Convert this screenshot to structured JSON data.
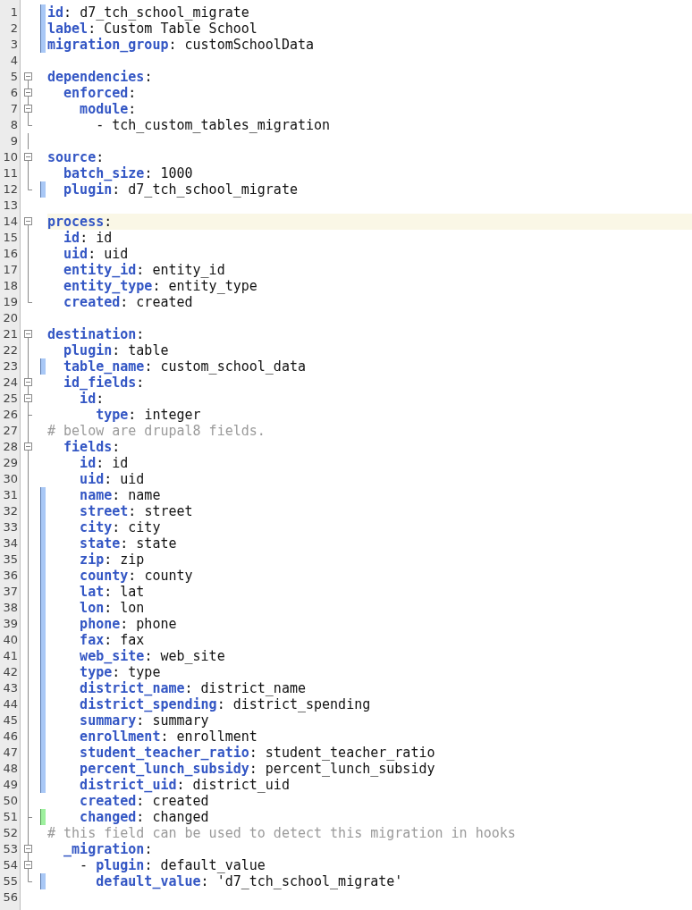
{
  "editor": {
    "lines": [
      {
        "number": "1",
        "kind": "plain",
        "modified": true,
        "added": false,
        "current": false,
        "segments": [
          {
            "kind": "key",
            "text": "id"
          },
          {
            "kind": "punct",
            "text": ": "
          },
          {
            "kind": "value",
            "text": "d7_tch_school_migrate"
          }
        ]
      },
      {
        "number": "2",
        "kind": "plain",
        "modified": true,
        "added": false,
        "current": false,
        "segments": [
          {
            "kind": "key",
            "text": "label"
          },
          {
            "kind": "punct",
            "text": ": "
          },
          {
            "kind": "value",
            "text": "Custom Table School"
          }
        ]
      },
      {
        "number": "3",
        "kind": "plain",
        "modified": true,
        "added": false,
        "current": false,
        "segments": [
          {
            "kind": "key",
            "text": "migration_group"
          },
          {
            "kind": "punct",
            "text": ": "
          },
          {
            "kind": "value",
            "text": "customSchoolData"
          }
        ]
      },
      {
        "number": "4",
        "kind": "plain",
        "modified": false,
        "added": false,
        "current": false
      },
      {
        "number": "5",
        "kind": "start",
        "modified": false,
        "added": false,
        "current": false,
        "segments": [
          {
            "kind": "key",
            "text": "dependencies"
          },
          {
            "kind": "punct",
            "text": ":"
          }
        ]
      },
      {
        "number": "6",
        "kind": "nested",
        "modified": false,
        "added": false,
        "current": false,
        "segments": [
          {
            "kind": "key",
            "text": "  enforced"
          },
          {
            "kind": "punct",
            "text": ":"
          }
        ]
      },
      {
        "number": "7",
        "kind": "nested",
        "modified": false,
        "added": false,
        "current": false,
        "segments": [
          {
            "kind": "key",
            "text": "    module"
          },
          {
            "kind": "punct",
            "text": ":"
          }
        ]
      },
      {
        "number": "8",
        "kind": "end",
        "modified": false,
        "added": false,
        "current": false,
        "segments": [
          {
            "kind": "value",
            "text": "      - tch_custom_tables_migration"
          }
        ]
      },
      {
        "number": "9",
        "kind": "line",
        "modified": false,
        "added": false,
        "current": false
      },
      {
        "number": "10",
        "kind": "start",
        "modified": false,
        "added": false,
        "current": false,
        "segments": [
          {
            "kind": "key",
            "text": "source"
          },
          {
            "kind": "punct",
            "text": ":"
          }
        ]
      },
      {
        "number": "11",
        "kind": "line",
        "modified": false,
        "added": false,
        "current": false,
        "segments": [
          {
            "kind": "key",
            "text": "  batch_size"
          },
          {
            "kind": "punct",
            "text": ": "
          },
          {
            "kind": "value",
            "text": "1000"
          }
        ]
      },
      {
        "number": "12",
        "kind": "end",
        "modified": true,
        "added": false,
        "current": false,
        "segments": [
          {
            "kind": "key",
            "text": "  plugin"
          },
          {
            "kind": "punct",
            "text": ": "
          },
          {
            "kind": "value",
            "text": "d7_tch_school_migrate"
          }
        ]
      },
      {
        "number": "13",
        "kind": "plain",
        "modified": false,
        "added": false,
        "current": false
      },
      {
        "number": "14",
        "kind": "start",
        "modified": false,
        "added": false,
        "current": true,
        "segments": [
          {
            "kind": "key",
            "text": "process"
          },
          {
            "kind": "punct",
            "text": ":"
          }
        ]
      },
      {
        "number": "15",
        "kind": "line",
        "modified": false,
        "added": false,
        "current": false,
        "segments": [
          {
            "kind": "key",
            "text": "  id"
          },
          {
            "kind": "punct",
            "text": ": "
          },
          {
            "kind": "value",
            "text": "id"
          }
        ]
      },
      {
        "number": "16",
        "kind": "line",
        "modified": false,
        "added": false,
        "current": false,
        "segments": [
          {
            "kind": "key",
            "text": "  uid"
          },
          {
            "kind": "punct",
            "text": ": "
          },
          {
            "kind": "value",
            "text": "uid"
          }
        ]
      },
      {
        "number": "17",
        "kind": "line",
        "modified": false,
        "added": false,
        "current": false,
        "segments": [
          {
            "kind": "key",
            "text": "  entity_id"
          },
          {
            "kind": "punct",
            "text": ": "
          },
          {
            "kind": "value",
            "text": "entity_id"
          }
        ]
      },
      {
        "number": "18",
        "kind": "line",
        "modified": false,
        "added": false,
        "current": false,
        "segments": [
          {
            "kind": "key",
            "text": "  entity_type"
          },
          {
            "kind": "punct",
            "text": ": "
          },
          {
            "kind": "value",
            "text": "entity_type"
          }
        ]
      },
      {
        "number": "19",
        "kind": "end",
        "modified": false,
        "added": false,
        "current": false,
        "segments": [
          {
            "kind": "key",
            "text": "  created"
          },
          {
            "kind": "punct",
            "text": ": "
          },
          {
            "kind": "value",
            "text": "created"
          }
        ]
      },
      {
        "number": "20",
        "kind": "plain",
        "modified": false,
        "added": false,
        "current": false
      },
      {
        "number": "21",
        "kind": "start",
        "modified": false,
        "added": false,
        "current": false,
        "segments": [
          {
            "kind": "key",
            "text": "destination"
          },
          {
            "kind": "punct",
            "text": ":"
          }
        ]
      },
      {
        "number": "22",
        "kind": "line",
        "modified": false,
        "added": false,
        "current": false,
        "segments": [
          {
            "kind": "key",
            "text": "  plugin"
          },
          {
            "kind": "punct",
            "text": ": "
          },
          {
            "kind": "value",
            "text": "table"
          }
        ]
      },
      {
        "number": "23",
        "kind": "line",
        "modified": true,
        "added": false,
        "current": false,
        "segments": [
          {
            "kind": "key",
            "text": "  table_name"
          },
          {
            "kind": "punct",
            "text": ": "
          },
          {
            "kind": "value",
            "text": "custom_school_data"
          }
        ]
      },
      {
        "number": "24",
        "kind": "nested",
        "modified": false,
        "added": false,
        "current": false,
        "segments": [
          {
            "kind": "key",
            "text": "  id_fields"
          },
          {
            "kind": "punct",
            "text": ":"
          }
        ]
      },
      {
        "number": "25",
        "kind": "nested",
        "modified": false,
        "added": false,
        "current": false,
        "segments": [
          {
            "kind": "key",
            "text": "    id"
          },
          {
            "kind": "punct",
            "text": ":"
          }
        ]
      },
      {
        "number": "26",
        "kind": "tee",
        "modified": false,
        "added": false,
        "current": false,
        "segments": [
          {
            "kind": "key",
            "text": "      type"
          },
          {
            "kind": "punct",
            "text": ": "
          },
          {
            "kind": "value",
            "text": "integer"
          }
        ]
      },
      {
        "number": "27",
        "kind": "line",
        "modified": false,
        "added": false,
        "current": false,
        "segments": [
          {
            "kind": "comment",
            "text": "# below are drupal8 fields."
          }
        ]
      },
      {
        "number": "28",
        "kind": "nested",
        "modified": false,
        "added": false,
        "current": false,
        "segments": [
          {
            "kind": "key",
            "text": "  fields"
          },
          {
            "kind": "punct",
            "text": ":"
          }
        ]
      },
      {
        "number": "29",
        "kind": "line",
        "modified": false,
        "added": false,
        "current": false,
        "segments": [
          {
            "kind": "key",
            "text": "    id"
          },
          {
            "kind": "punct",
            "text": ": "
          },
          {
            "kind": "value",
            "text": "id"
          }
        ]
      },
      {
        "number": "30",
        "kind": "line",
        "modified": false,
        "added": false,
        "current": false,
        "segments": [
          {
            "kind": "key",
            "text": "    uid"
          },
          {
            "kind": "punct",
            "text": ": "
          },
          {
            "kind": "value",
            "text": "uid"
          }
        ]
      },
      {
        "number": "31",
        "kind": "line",
        "modified": true,
        "added": false,
        "current": false,
        "segments": [
          {
            "kind": "key",
            "text": "    name"
          },
          {
            "kind": "punct",
            "text": ": "
          },
          {
            "kind": "value",
            "text": "name"
          }
        ]
      },
      {
        "number": "32",
        "kind": "line",
        "modified": true,
        "added": false,
        "current": false,
        "segments": [
          {
            "kind": "key",
            "text": "    street"
          },
          {
            "kind": "punct",
            "text": ": "
          },
          {
            "kind": "value",
            "text": "street"
          }
        ]
      },
      {
        "number": "33",
        "kind": "line",
        "modified": true,
        "added": false,
        "current": false,
        "segments": [
          {
            "kind": "key",
            "text": "    city"
          },
          {
            "kind": "punct",
            "text": ": "
          },
          {
            "kind": "value",
            "text": "city"
          }
        ]
      },
      {
        "number": "34",
        "kind": "line",
        "modified": true,
        "added": false,
        "current": false,
        "segments": [
          {
            "kind": "key",
            "text": "    state"
          },
          {
            "kind": "punct",
            "text": ": "
          },
          {
            "kind": "value",
            "text": "state"
          }
        ]
      },
      {
        "number": "35",
        "kind": "line",
        "modified": true,
        "added": false,
        "current": false,
        "segments": [
          {
            "kind": "key",
            "text": "    zip"
          },
          {
            "kind": "punct",
            "text": ": "
          },
          {
            "kind": "value",
            "text": "zip"
          }
        ]
      },
      {
        "number": "36",
        "kind": "line",
        "modified": true,
        "added": false,
        "current": false,
        "segments": [
          {
            "kind": "key",
            "text": "    county"
          },
          {
            "kind": "punct",
            "text": ": "
          },
          {
            "kind": "value",
            "text": "county"
          }
        ]
      },
      {
        "number": "37",
        "kind": "line",
        "modified": true,
        "added": false,
        "current": false,
        "segments": [
          {
            "kind": "key",
            "text": "    lat"
          },
          {
            "kind": "punct",
            "text": ": "
          },
          {
            "kind": "value",
            "text": "lat"
          }
        ]
      },
      {
        "number": "38",
        "kind": "line",
        "modified": true,
        "added": false,
        "current": false,
        "segments": [
          {
            "kind": "key",
            "text": "    lon"
          },
          {
            "kind": "punct",
            "text": ": "
          },
          {
            "kind": "value",
            "text": "lon"
          }
        ]
      },
      {
        "number": "39",
        "kind": "line",
        "modified": true,
        "added": false,
        "current": false,
        "segments": [
          {
            "kind": "key",
            "text": "    phone"
          },
          {
            "kind": "punct",
            "text": ": "
          },
          {
            "kind": "value",
            "text": "phone"
          }
        ]
      },
      {
        "number": "40",
        "kind": "line",
        "modified": true,
        "added": false,
        "current": false,
        "segments": [
          {
            "kind": "key",
            "text": "    fax"
          },
          {
            "kind": "punct",
            "text": ": "
          },
          {
            "kind": "value",
            "text": "fax"
          }
        ]
      },
      {
        "number": "41",
        "kind": "line",
        "modified": true,
        "added": false,
        "current": false,
        "segments": [
          {
            "kind": "key",
            "text": "    web_site"
          },
          {
            "kind": "punct",
            "text": ": "
          },
          {
            "kind": "value",
            "text": "web_site"
          }
        ]
      },
      {
        "number": "42",
        "kind": "line",
        "modified": true,
        "added": false,
        "current": false,
        "segments": [
          {
            "kind": "key",
            "text": "    type"
          },
          {
            "kind": "punct",
            "text": ": "
          },
          {
            "kind": "value",
            "text": "type"
          }
        ]
      },
      {
        "number": "43",
        "kind": "line",
        "modified": true,
        "added": false,
        "current": false,
        "segments": [
          {
            "kind": "key",
            "text": "    district_name"
          },
          {
            "kind": "punct",
            "text": ": "
          },
          {
            "kind": "value",
            "text": "district_name"
          }
        ]
      },
      {
        "number": "44",
        "kind": "line",
        "modified": true,
        "added": false,
        "current": false,
        "segments": [
          {
            "kind": "key",
            "text": "    district_spending"
          },
          {
            "kind": "punct",
            "text": ": "
          },
          {
            "kind": "value",
            "text": "district_spending"
          }
        ]
      },
      {
        "number": "45",
        "kind": "line",
        "modified": true,
        "added": false,
        "current": false,
        "segments": [
          {
            "kind": "key",
            "text": "    summary"
          },
          {
            "kind": "punct",
            "text": ": "
          },
          {
            "kind": "value",
            "text": "summary"
          }
        ]
      },
      {
        "number": "46",
        "kind": "line",
        "modified": true,
        "added": false,
        "current": false,
        "segments": [
          {
            "kind": "key",
            "text": "    enrollment"
          },
          {
            "kind": "punct",
            "text": ": "
          },
          {
            "kind": "value",
            "text": "enrollment"
          }
        ]
      },
      {
        "number": "47",
        "kind": "line",
        "modified": true,
        "added": false,
        "current": false,
        "segments": [
          {
            "kind": "key",
            "text": "    student_teacher_ratio"
          },
          {
            "kind": "punct",
            "text": ": "
          },
          {
            "kind": "value",
            "text": "student_teacher_ratio"
          }
        ]
      },
      {
        "number": "48",
        "kind": "line",
        "modified": true,
        "added": false,
        "current": false,
        "segments": [
          {
            "kind": "key",
            "text": "    percent_lunch_subsidy"
          },
          {
            "kind": "punct",
            "text": ": "
          },
          {
            "kind": "value",
            "text": "percent_lunch_subsidy"
          }
        ]
      },
      {
        "number": "49",
        "kind": "line",
        "modified": true,
        "added": false,
        "current": false,
        "segments": [
          {
            "kind": "key",
            "text": "    district_uid"
          },
          {
            "kind": "punct",
            "text": ": "
          },
          {
            "kind": "value",
            "text": "district_uid"
          }
        ]
      },
      {
        "number": "50",
        "kind": "line",
        "modified": false,
        "added": false,
        "current": false,
        "segments": [
          {
            "kind": "key",
            "text": "    created"
          },
          {
            "kind": "punct",
            "text": ": "
          },
          {
            "kind": "value",
            "text": "created"
          }
        ]
      },
      {
        "number": "51",
        "kind": "tee",
        "modified": false,
        "added": true,
        "current": false,
        "segments": [
          {
            "kind": "key",
            "text": "    changed"
          },
          {
            "kind": "punct",
            "text": ": "
          },
          {
            "kind": "value",
            "text": "changed"
          }
        ]
      },
      {
        "number": "52",
        "kind": "line",
        "modified": false,
        "added": false,
        "current": false,
        "segments": [
          {
            "kind": "comment",
            "text": "# this field can be used to detect this migration in hooks"
          }
        ]
      },
      {
        "number": "53",
        "kind": "nested",
        "modified": false,
        "added": false,
        "current": false,
        "segments": [
          {
            "kind": "key",
            "text": "  _migration"
          },
          {
            "kind": "punct",
            "text": ":"
          }
        ]
      },
      {
        "number": "54",
        "kind": "nested",
        "modified": false,
        "added": false,
        "current": false,
        "segments": [
          {
            "kind": "punct",
            "text": "    - "
          },
          {
            "kind": "key",
            "text": "plugin"
          },
          {
            "kind": "punct",
            "text": ": "
          },
          {
            "kind": "value",
            "text": "default_value"
          }
        ]
      },
      {
        "number": "55",
        "kind": "end",
        "modified": true,
        "added": false,
        "current": false,
        "segments": [
          {
            "kind": "key",
            "text": "      default_value"
          },
          {
            "kind": "punct",
            "text": ": "
          },
          {
            "kind": "value",
            "text": "'d7_tch_school_migrate'"
          }
        ]
      },
      {
        "number": "56",
        "kind": "plain",
        "modified": false,
        "added": false,
        "current": false
      }
    ]
  }
}
